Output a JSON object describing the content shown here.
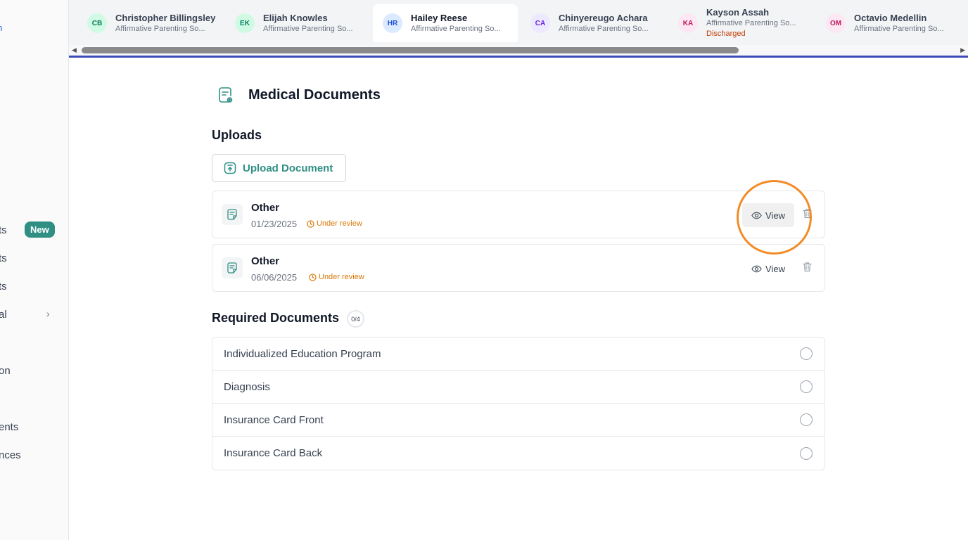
{
  "sidebar": {
    "top_fragment": "n",
    "items": [
      {
        "label": "ts",
        "badge": "New"
      },
      {
        "label": "ts"
      },
      {
        "label": "ts"
      },
      {
        "label": "al",
        "chevron": "›"
      },
      {
        "label": "on"
      },
      {
        "label": "ents"
      },
      {
        "label": "nces"
      }
    ]
  },
  "tabs": [
    {
      "initials": "CB",
      "name": "Christopher Billingsley",
      "subtitle": "Affirmative Parenting So...",
      "avatar_bg": "#d1fae5",
      "avatar_fg": "#047857"
    },
    {
      "initials": "EK",
      "name": "Elijah Knowles",
      "subtitle": "Affirmative Parenting So...",
      "avatar_bg": "#d1fae5",
      "avatar_fg": "#047857"
    },
    {
      "initials": "HR",
      "name": "Hailey Reese",
      "subtitle": "Affirmative Parenting So...",
      "avatar_bg": "#dbeafe",
      "avatar_fg": "#1d4ed8",
      "active": true
    },
    {
      "initials": "CA",
      "name": "Chinyereugo Achara",
      "subtitle": "Affirmative Parenting So...",
      "avatar_bg": "#ede9fe",
      "avatar_fg": "#6d28d9"
    },
    {
      "initials": "KA",
      "name": "Kayson Assah",
      "subtitle": "Affirmative Parenting So...",
      "status": "Discharged",
      "avatar_bg": "#fce7f3",
      "avatar_fg": "#be185d"
    },
    {
      "initials": "OM",
      "name": "Octavio Medellin",
      "subtitle": "Affirmative Parenting So...",
      "avatar_bg": "#fce7f3",
      "avatar_fg": "#be185d"
    }
  ],
  "page": {
    "title": "Medical Documents",
    "icon": "medical-document-icon"
  },
  "uploads": {
    "heading": "Uploads",
    "upload_button": "Upload Document",
    "documents": [
      {
        "name": "Other",
        "date": "01/23/2025",
        "status": "Under review",
        "view_label": "View"
      },
      {
        "name": "Other",
        "date": "06/06/2025",
        "status": "Under review",
        "view_label": "View"
      }
    ]
  },
  "required": {
    "heading": "Required Documents",
    "count": "0/4",
    "items": [
      {
        "label": "Individualized Education Program"
      },
      {
        "label": "Diagnosis"
      },
      {
        "label": "Insurance Card Front"
      },
      {
        "label": "Insurance Card Back"
      }
    ]
  },
  "colors": {
    "accent": "#2f8f83",
    "status_review": "#d97706",
    "highlight": "#f28c28",
    "tab_rule": "#3b4ab8",
    "discharged": "#c2410c"
  }
}
